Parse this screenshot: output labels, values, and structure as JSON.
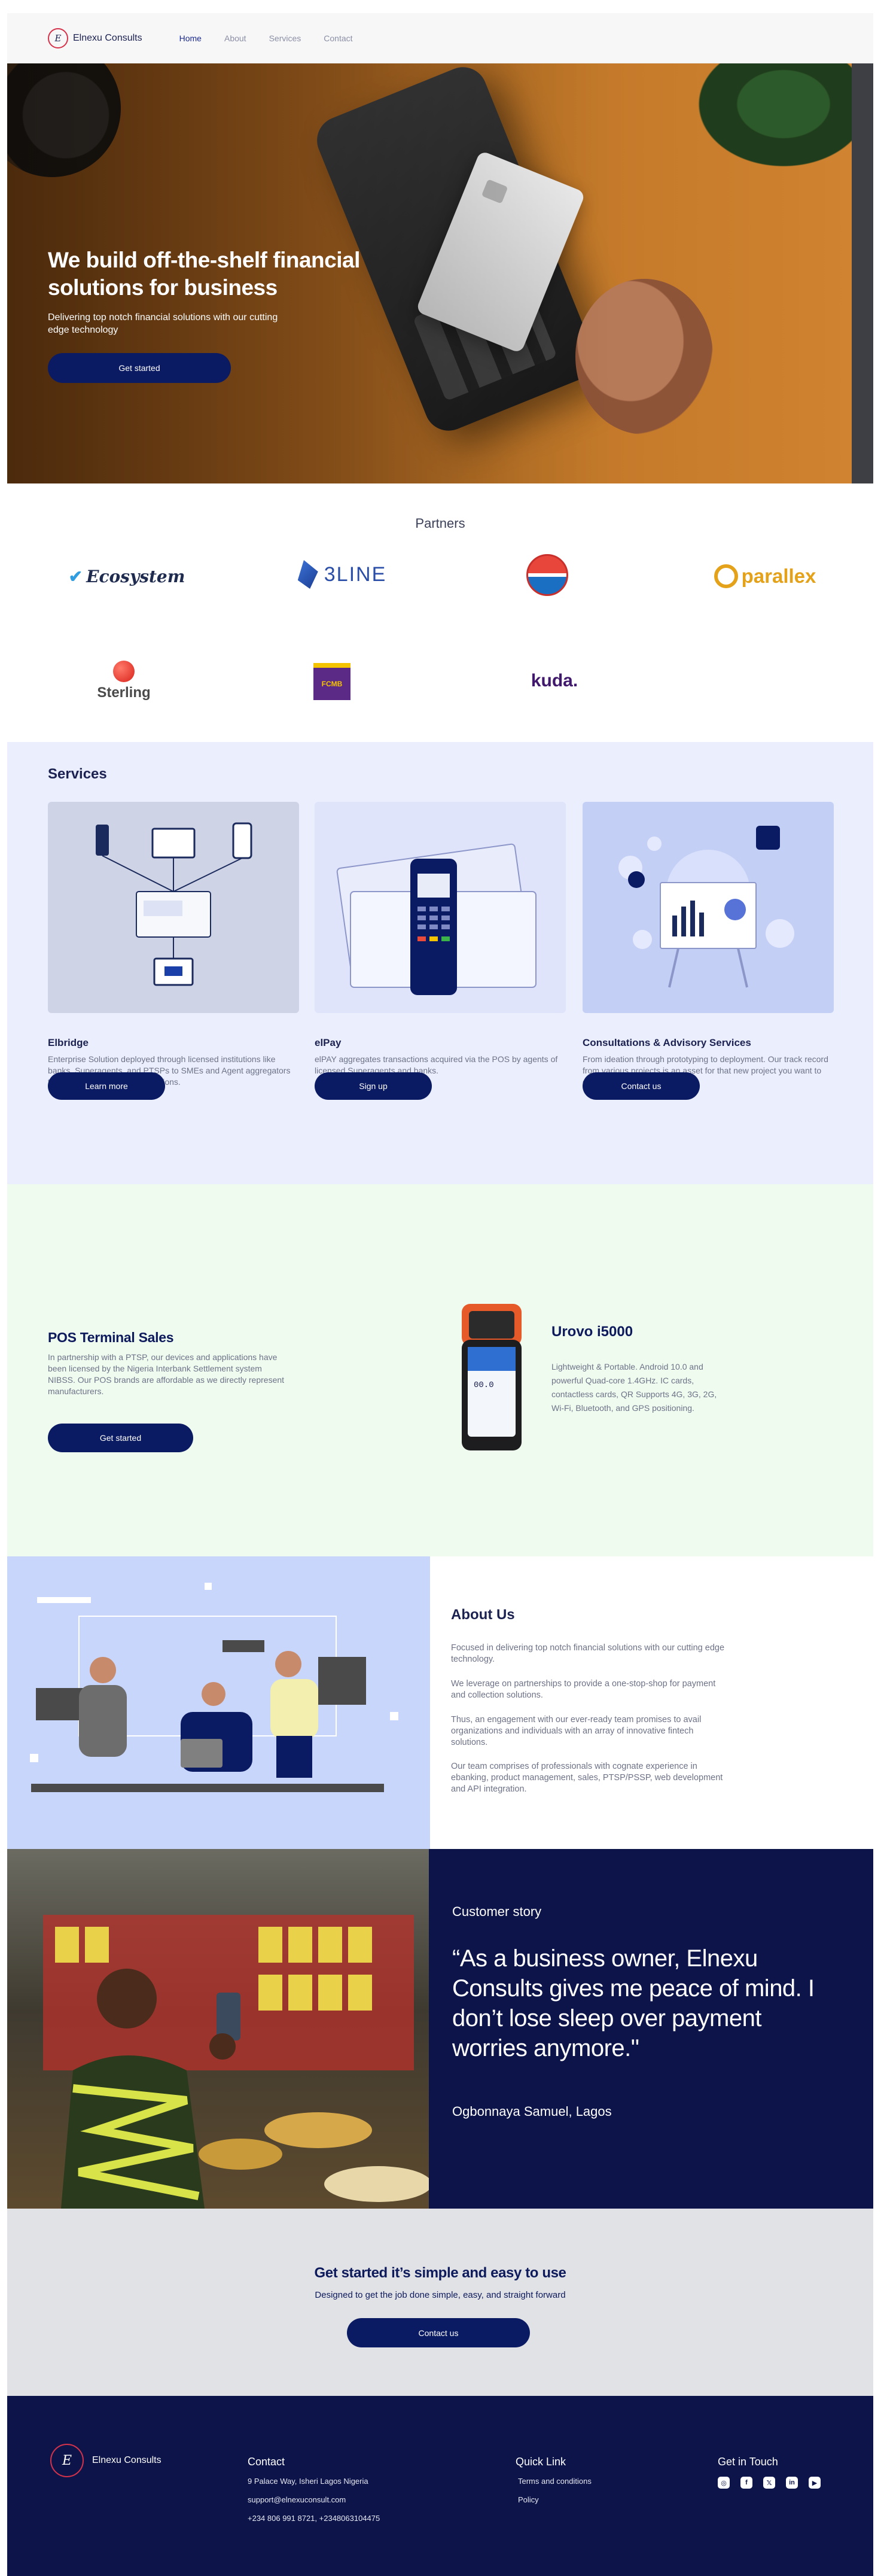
{
  "brand": {
    "name": "Elnexu Consults",
    "mark": "E"
  },
  "nav": {
    "items": [
      "Home",
      "About",
      "Services",
      "Contact"
    ]
  },
  "hero": {
    "title": "We build off-the-shelf financial solutions for business",
    "subtitle": "Delivering top notch financial solutions with our cutting edge technology",
    "cta": "Get started"
  },
  "partners": {
    "title": "Partners",
    "logos": {
      "ecosystem": "Ecosystem",
      "threeline": "3LINE",
      "parallex": "parallex",
      "sterling": "Sterling",
      "fcmb": "FCMB",
      "kuda": "kuda."
    }
  },
  "services": {
    "title": "Services",
    "items": [
      {
        "title": "Elbridge",
        "desc": "Enterprise Solution deployed through licensed institutions like banks, Superagents, and PTSPs to SMEs and Agent aggregators to have control of their transactions.",
        "cta": "Learn more"
      },
      {
        "title": "elPay",
        "desc": "elPAY aggregates transactions acquired via the POS by agents of licensed Superagents and banks.",
        "cta": "Sign up"
      },
      {
        "title": "Consultations & Advisory Services",
        "desc": "From ideation through prototyping to deployment. Our track record from various projects is an asset for that new project you want to deploy.",
        "cta": "Contact us"
      }
    ]
  },
  "pos": {
    "title": "POS Terminal Sales",
    "desc": "In partnership with a PTSP, our devices and applications have been licensed by the Nigeria Interbank Settlement system NIBSS. Our POS brands are affordable as we directly represent manufacturers.",
    "cta": "Get started",
    "device_name": "Urovo i5000",
    "device_screen": "00.0",
    "device_desc": "Lightweight & Portable. Android 10.0 and powerful Quad-core 1.4GHz. IC cards, contactless cards, QR Supports 4G, 3G, 2G, Wi-Fi, Bluetooth, and GPS positioning."
  },
  "about": {
    "title": "About Us",
    "paragraphs": [
      "Focused in delivering top notch financial solutions with our cutting edge technology.",
      "We leverage on partnerships to provide a one-stop-shop for payment and collection solutions.",
      "Thus, an engagement with our ever-ready team promises to avail organizations and individuals with an array of innovative fintech solutions.",
      "Our team comprises of professionals with cognate experience in ebanking, product management, sales, PTSP/PSSP, web development and API integration."
    ]
  },
  "story": {
    "label": "Customer story",
    "quote": "“As a business owner, Elnexu Consults gives me peace of mind. I don’t lose sleep over payment worries anymore.\"",
    "author": "Ogbonnaya Samuel, Lagos"
  },
  "cta": {
    "title": "Get started it’s simple and easy to use",
    "subtitle": "Designed to get the job done simple, easy, and straight forward",
    "button": "Contact us"
  },
  "footer": {
    "brand": "Elnexu Consults",
    "contact": {
      "heading": "Contact",
      "address": "9 Palace Way, Isheri Lagos Nigeria",
      "email": "support@elnexuconsult.com",
      "phone": "+234 806 991 8721,  +2348063104475"
    },
    "quick": {
      "heading": "Quick Link",
      "items": [
        "Terms and conditions",
        "Policy"
      ]
    },
    "touch": {
      "heading": "Get in Touch",
      "icons": [
        "instagram-icon",
        "facebook-icon",
        "x-icon",
        "linkedin-icon",
        "youtube-icon"
      ]
    }
  },
  "colors": {
    "navy": "#0b1b63",
    "footer_bg": "#0c1449",
    "services_bg": "#eaeefd",
    "pos_bg": "#f0fbf0",
    "cta_bg": "#e1e2e5"
  }
}
